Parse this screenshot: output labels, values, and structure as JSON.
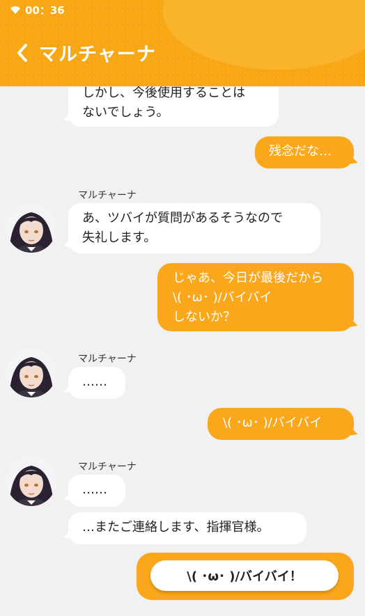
{
  "status_bar": {
    "time": "00：36"
  },
  "header": {
    "title": "マルチャーナ",
    "back_icon": "chevron-left-icon"
  },
  "messages": [
    {
      "side": "left",
      "lines": [
        "しかし、今後使用することは",
        "ないでしょう。"
      ]
    },
    {
      "side": "right",
      "lines": [
        "残念だな…"
      ]
    },
    {
      "side": "left",
      "sender": "マルチャーナ",
      "lines": [
        "あ、ツバイが質問があるそうなので",
        "失礼します。"
      ]
    },
    {
      "side": "right",
      "lines": [
        "じゃあ、今日が最後だから",
        "\\( ･ω･ )/バイバイ",
        "しないか？"
      ]
    },
    {
      "side": "left",
      "sender": "マルチャーナ",
      "lines": [
        "……"
      ]
    },
    {
      "side": "right",
      "lines": [
        "\\( ･ω･ )/バイバイ"
      ]
    },
    {
      "side": "left",
      "sender": "マルチャーナ",
      "lines": [
        "……"
      ]
    },
    {
      "side": "left",
      "lines": [
        "…またご連絡します、指揮官様。"
      ]
    }
  ],
  "reply_choice": {
    "label": "\\( ･ω･ )/バイバイ！"
  },
  "colors": {
    "header": "#f8a714",
    "accent": "#fba71b",
    "background": "#f1f1f1",
    "bubble_left": "#ffffff"
  }
}
